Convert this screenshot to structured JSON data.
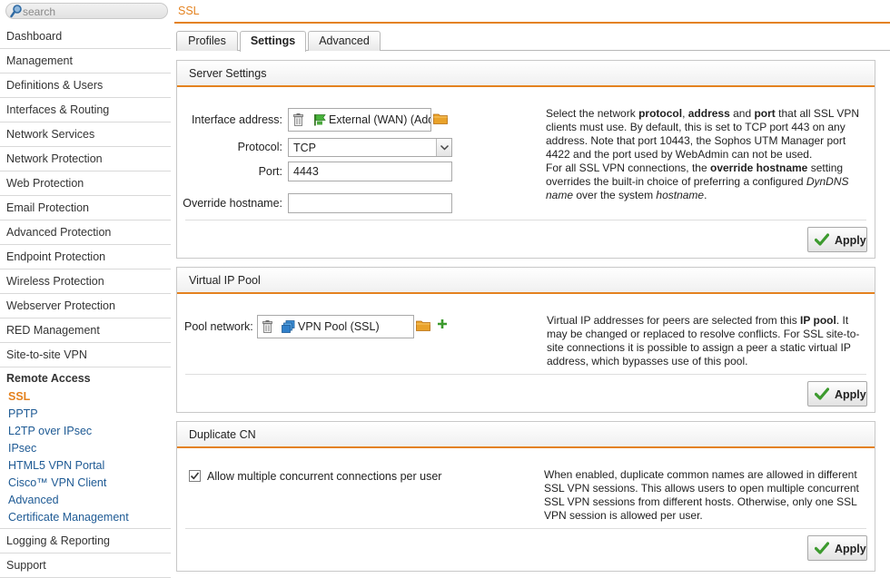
{
  "search": {
    "placeholder": "search"
  },
  "sidebar": {
    "items": [
      {
        "label": "Dashboard"
      },
      {
        "label": "Management"
      },
      {
        "label": "Definitions & Users"
      },
      {
        "label": "Interfaces & Routing"
      },
      {
        "label": "Network Services"
      },
      {
        "label": "Network Protection"
      },
      {
        "label": "Web Protection"
      },
      {
        "label": "Email Protection"
      },
      {
        "label": "Advanced Protection"
      },
      {
        "label": "Endpoint Protection"
      },
      {
        "label": "Wireless Protection"
      },
      {
        "label": "Webserver Protection"
      },
      {
        "label": "RED Management"
      },
      {
        "label": "Site-to-site VPN"
      }
    ],
    "active_section": "Remote Access",
    "sub_items": [
      {
        "label": "SSL",
        "selected": true
      },
      {
        "label": "PPTP"
      },
      {
        "label": "L2TP over IPsec"
      },
      {
        "label": "IPsec"
      },
      {
        "label": "HTML5 VPN Portal"
      },
      {
        "label": "Cisco™ VPN Client"
      },
      {
        "label": "Advanced"
      },
      {
        "label": "Certificate Management"
      }
    ],
    "after_items": [
      {
        "label": "Logging & Reporting"
      },
      {
        "label": "Support"
      }
    ]
  },
  "page": {
    "title": "SSL"
  },
  "tabs": [
    {
      "label": "Profiles"
    },
    {
      "label": "Settings",
      "active": true
    },
    {
      "label": "Advanced"
    }
  ],
  "server_settings": {
    "title": "Server Settings",
    "interface_label": "Interface address:",
    "interface_value": "External (WAN) (Address)",
    "protocol_label": "Protocol:",
    "protocol_value": "TCP",
    "port_label": "Port:",
    "port_value": "4443",
    "hostname_label": "Override hostname:",
    "hostname_value": "",
    "desc": {
      "t1": "Select the network ",
      "b1": "protocol",
      "t2": ", ",
      "b2": "address",
      "t3": " and ",
      "b3": "port",
      "t4": " that all SSL VPN clients must use. By default, this is set to TCP port 443 on any address. Note that port 10443, the Sophos UTM Manager port 4422 and the port used by WebAdmin can not be used.",
      "t5": "For all SSL VPN connections, the ",
      "b4": "override hostname",
      "t6": " setting overrides the built-in choice of preferring a configured ",
      "i1": "DynDNS name",
      "t7": " over the system ",
      "i2": "hostname",
      "t8": "."
    },
    "apply_label": "Apply"
  },
  "virtual_ip_pool": {
    "title": "Virtual IP Pool",
    "pool_label": "Pool network:",
    "pool_value": "VPN Pool (SSL)",
    "desc": {
      "t1": "Virtual IP addresses for peers are selected from this ",
      "b1": "IP pool",
      "t2": ". It may be changed or replaced to resolve conflicts. For SSL site-to-site connections it is possible to assign a peer a static virtual IP address, which bypasses use of this pool."
    },
    "apply_label": "Apply"
  },
  "duplicate_cn": {
    "title": "Duplicate CN",
    "checkbox_label": "Allow multiple concurrent connections per user",
    "checked": true,
    "desc": "When enabled, duplicate common names are allowed in different SSL VPN sessions. This allows users to open multiple concurrent SSL VPN sessions from different hosts. Otherwise, only one SSL VPN session is allowed per user.",
    "apply_label": "Apply"
  },
  "colors": {
    "accent": "#e4821f",
    "link": "#1e5a94",
    "apply_check": "#3c9a2e"
  }
}
